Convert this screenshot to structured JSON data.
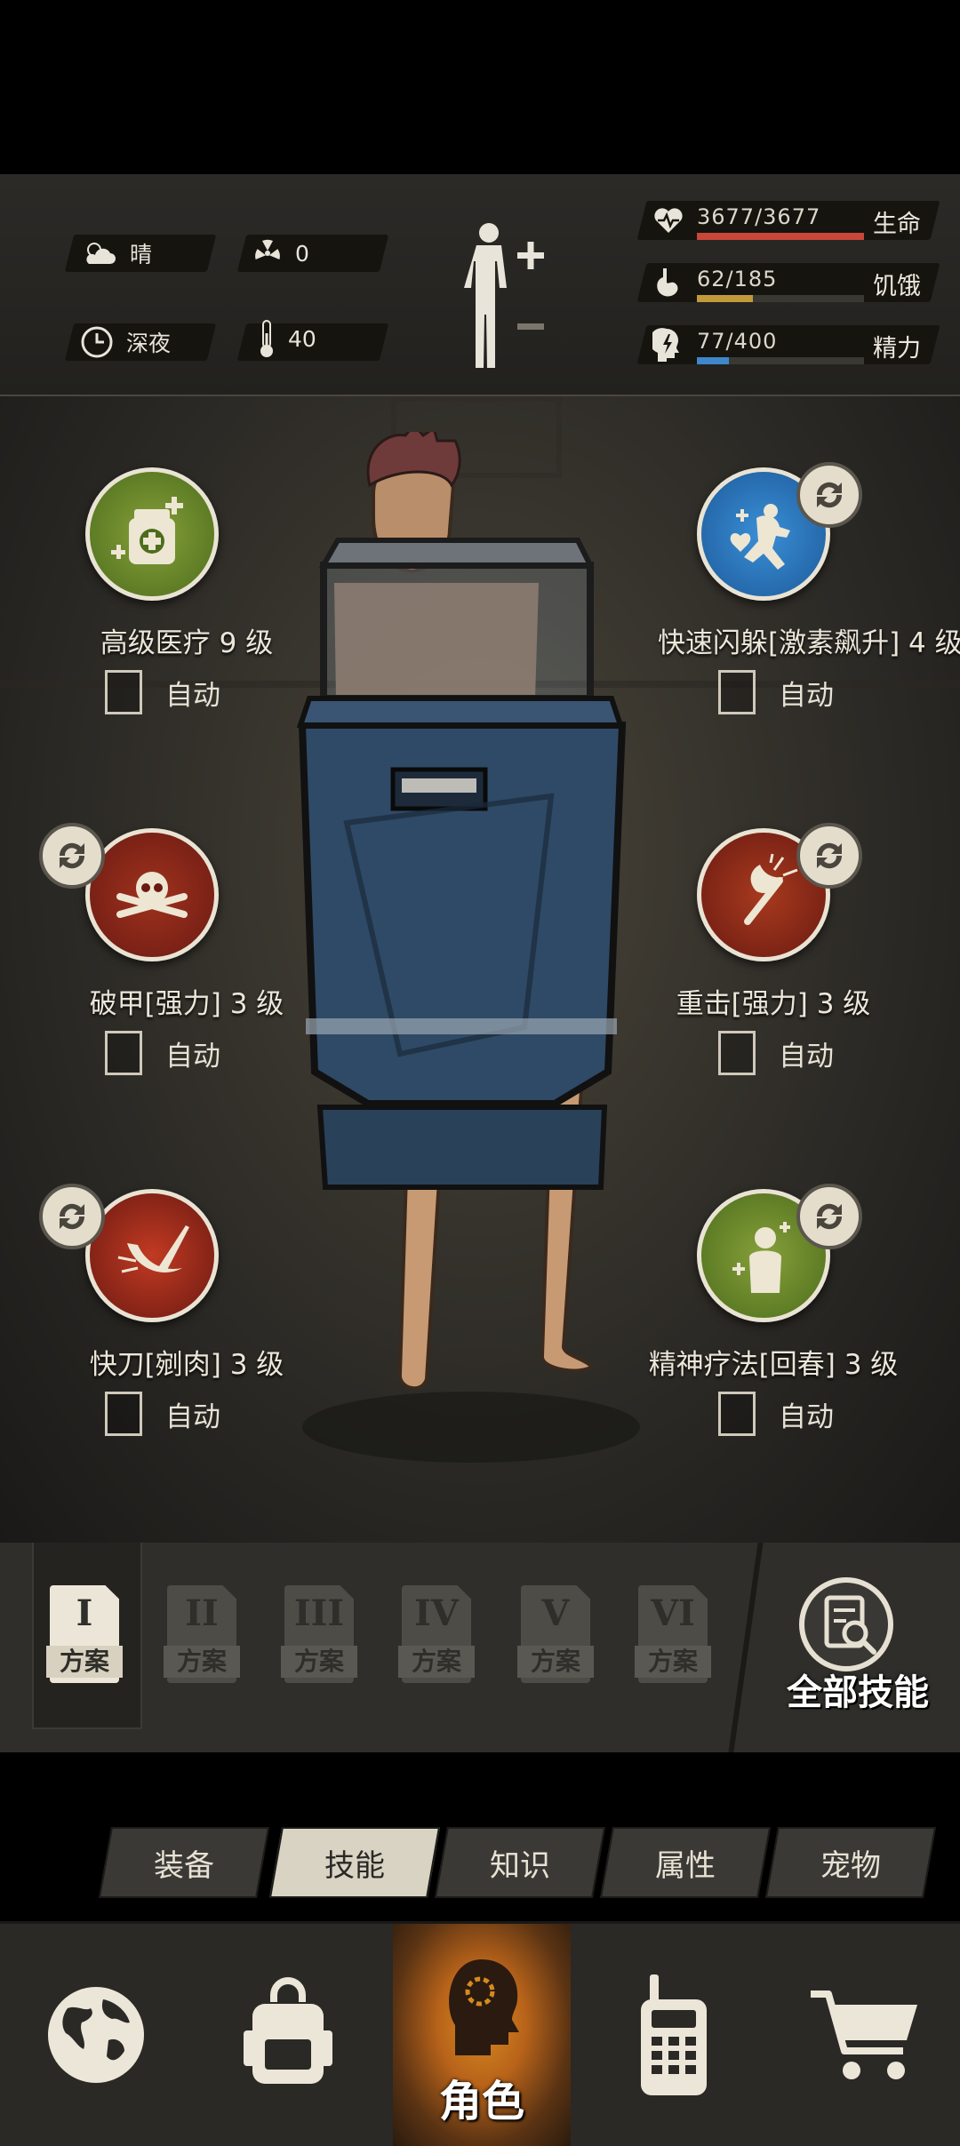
{
  "status": {
    "weather": {
      "label": "晴",
      "icon": "cloud-sun-icon"
    },
    "radiation": {
      "value": "0",
      "icon": "radiation-icon"
    },
    "time": {
      "label": "深夜",
      "icon": "clock-icon"
    },
    "temperature": {
      "value": "40",
      "icon": "thermometer-icon"
    },
    "stats": [
      {
        "id": "health",
        "value": "3677/3677",
        "label": "生命",
        "fraction": 1.0,
        "color": "#c9473a",
        "icon": "heart-pulse-icon"
      },
      {
        "id": "hunger",
        "value": "62/185",
        "label": "饥饿",
        "fraction": 0.335,
        "color": "#c29a3a",
        "icon": "stomach-icon"
      },
      {
        "id": "energy",
        "value": "77/400",
        "label": "精力",
        "fraction": 0.19,
        "color": "#3f87c8",
        "icon": "head-bolt-icon"
      }
    ]
  },
  "skills": [
    {
      "name": "高级医疗 9 级",
      "auto": "自动",
      "icon": "medical-kit-icon",
      "swap": false
    },
    {
      "name": "快速闪躲[激素飙升] 4 级",
      "auto": "自动",
      "icon": "dodge-heal-icon",
      "swap": true
    },
    {
      "name": "破甲[强力] 3 级",
      "auto": "自动",
      "icon": "skull-crossbones-icon",
      "swap": true
    },
    {
      "name": "重击[强力] 3 级",
      "auto": "自动",
      "icon": "axe-strike-icon",
      "swap": true
    },
    {
      "name": "快刀[剜肉] 3 级",
      "auto": "自动",
      "icon": "blade-slash-icon",
      "swap": true
    },
    {
      "name": "精神疗法[回春] 3 级",
      "auto": "自动",
      "icon": "spirit-heal-icon",
      "swap": true
    }
  ],
  "plans": [
    {
      "roman": "I",
      "word": "方案",
      "active": true
    },
    {
      "roman": "II",
      "word": "方案",
      "active": false
    },
    {
      "roman": "III",
      "word": "方案",
      "active": false
    },
    {
      "roman": "IV",
      "word": "方案",
      "active": false
    },
    {
      "roman": "V",
      "word": "方案",
      "active": false
    },
    {
      "roman": "VI",
      "word": "方案",
      "active": false
    }
  ],
  "all_skills_label": "全部技能",
  "subtabs": [
    {
      "label": "装备",
      "active": false
    },
    {
      "label": "技能",
      "active": true
    },
    {
      "label": "知识",
      "active": false
    },
    {
      "label": "属性",
      "active": false
    },
    {
      "label": "宠物",
      "active": false
    }
  ],
  "nav": [
    {
      "icon": "globe-icon"
    },
    {
      "icon": "backpack-icon"
    },
    {
      "icon": "character-head-icon",
      "label": "角色",
      "active": true
    },
    {
      "icon": "walkie-talkie-icon"
    },
    {
      "icon": "shopping-cart-icon"
    }
  ]
}
